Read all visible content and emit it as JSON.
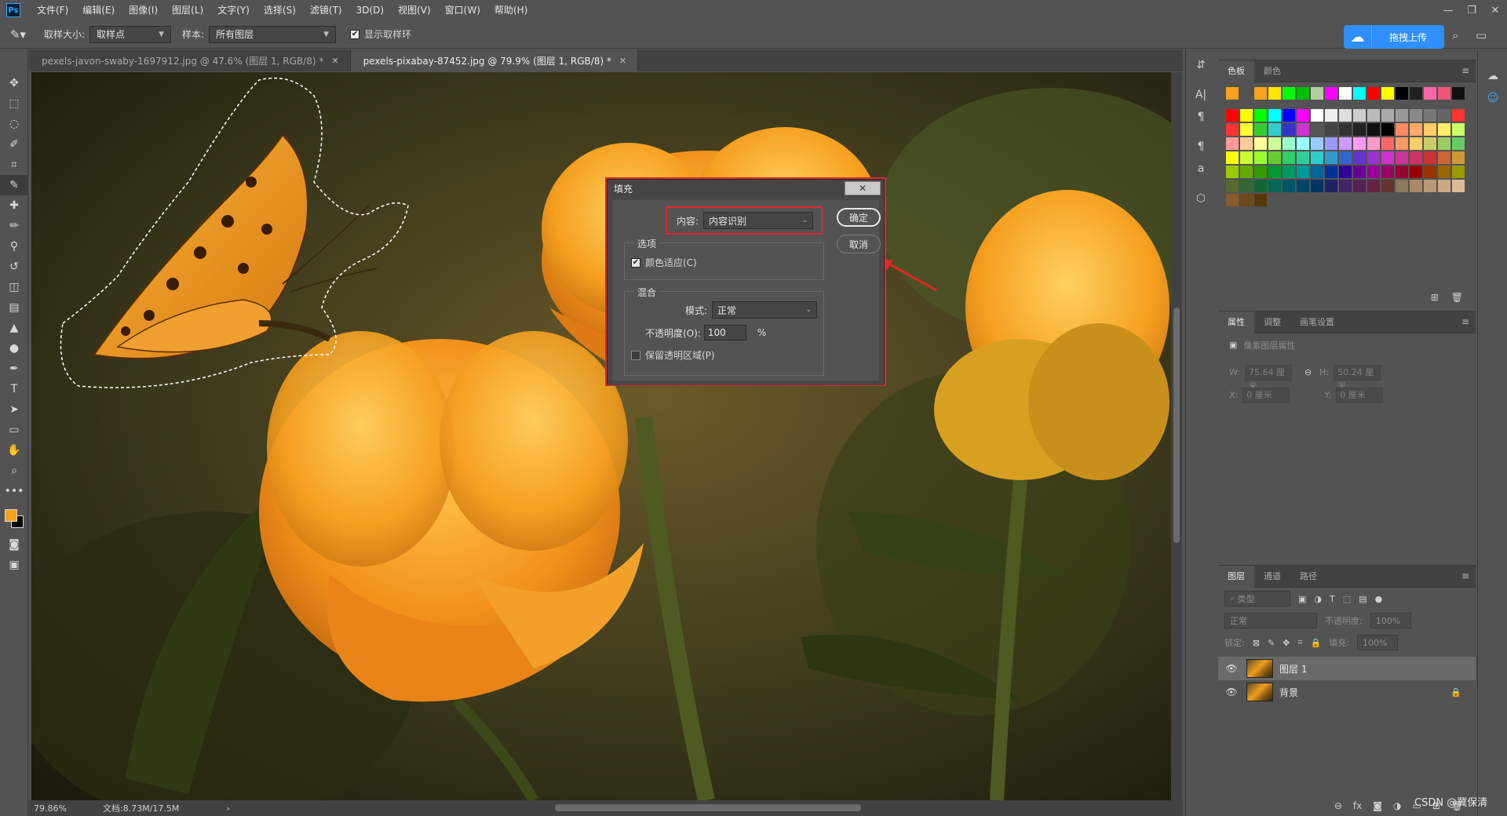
{
  "menubar": {
    "logo": "Ps",
    "items": [
      "文件(F)",
      "编辑(E)",
      "图像(I)",
      "图层(L)",
      "文字(Y)",
      "选择(S)",
      "滤镜(T)",
      "3D(D)",
      "视图(V)",
      "窗口(W)",
      "帮助(H)"
    ],
    "window_controls": [
      "—",
      "❐",
      "✕"
    ]
  },
  "options": {
    "sample_size_label": "取样大小:",
    "sample_size_value": "取样点",
    "sample_label": "样本:",
    "sample_value": "所有图层",
    "show_ring_label": "显示取样环",
    "show_ring_checked": true,
    "upload_label": "拖拽上传"
  },
  "tabs": [
    {
      "label": "pexels-javon-swaby-1697912.jpg @ 47.6% (图层 1, RGB/8) *",
      "active": false
    },
    {
      "label": "pexels-pixabay-87452.jpg @ 79.9% (图层 1, RGB/8) *",
      "active": true
    }
  ],
  "status": {
    "zoom": "79.86%",
    "doc": "文档:8.73M/17.5M"
  },
  "colors": {
    "foreground": "#f7a21b",
    "background": "#000000",
    "highlight": "#e12727",
    "accent": "#2f8fff"
  },
  "dialog": {
    "title": "填充",
    "content_label": "内容:",
    "content_value": "内容识别",
    "ok_label": "确定",
    "cancel_label": "取消",
    "options_title": "选项",
    "color_adapt_label": "颜色适应(C)",
    "color_adapt_checked": true,
    "blend_title": "混合",
    "mode_label": "模式:",
    "mode_value": "正常",
    "opacity_label": "不透明度(O):",
    "opacity_value": "100",
    "opacity_unit": "%",
    "preserve_label": "保留透明区域(P)",
    "preserve_checked": false
  },
  "swatches_panel": {
    "tabs": [
      "色板",
      "颜色"
    ]
  },
  "properties_panel": {
    "tabs": [
      "属性",
      "调整",
      "画笔设置"
    ],
    "section_label": "像素图层属性",
    "w_label": "W:",
    "w_value": "75.64 厘米",
    "h_label": "H:",
    "h_value": "50.24 厘米",
    "x_label": "X:",
    "x_value": "0 厘米",
    "y_label": "Y:",
    "y_value": "0 厘米"
  },
  "layers_panel": {
    "tabs": [
      "图层",
      "通道",
      "路径"
    ],
    "filter_label": "类型",
    "blend_mode": "正常",
    "opacity_label": "不透明度:",
    "opacity_value": "100%",
    "lock_label": "锁定:",
    "fill_label": "填充:",
    "fill_value": "100%",
    "layers": [
      {
        "name": "图层 1",
        "active": true,
        "locked": false
      },
      {
        "name": "背景",
        "active": false,
        "locked": true
      }
    ]
  },
  "watermark": "CSDN @冀保清"
}
